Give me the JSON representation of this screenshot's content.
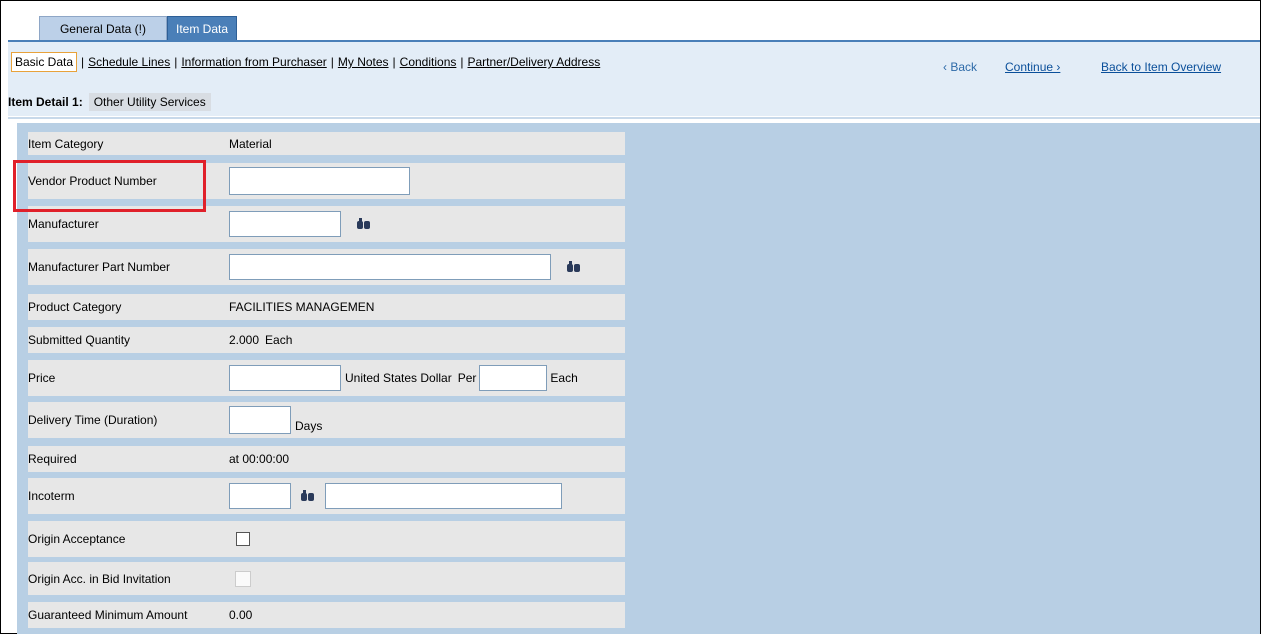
{
  "tabs": [
    {
      "label": "General Data (!)",
      "active": false
    },
    {
      "label": "Item Data",
      "active": true
    }
  ],
  "subnav": {
    "links": [
      "Basic Data",
      "Schedule Lines",
      "Information from Purchaser",
      "My Notes",
      "Conditions",
      "Partner/Delivery Address"
    ],
    "active": "Basic Data",
    "separator": "|",
    "back": "‹ Back",
    "continue": "Continue ›",
    "overview": "Back to Item Overview"
  },
  "detail": {
    "label": "Item Detail 1:",
    "value": "Other Utility Services"
  },
  "fields": {
    "item_category": {
      "label": "Item Category",
      "value": "Material"
    },
    "vendor_product_number": {
      "label": "Vendor Product Number",
      "value": ""
    },
    "manufacturer": {
      "label": "Manufacturer",
      "value": ""
    },
    "manufacturer_part_number": {
      "label": "Manufacturer Part Number",
      "value": ""
    },
    "product_category": {
      "label": "Product Category",
      "value": "FACILITIES MANAGEMEN"
    },
    "submitted_quantity": {
      "label": "Submitted Quantity",
      "value": "2.000",
      "unit": "Each"
    },
    "price": {
      "label": "Price",
      "value": "",
      "currency": "United States Dollar",
      "per_label": "Per",
      "per_value": "",
      "unit": "Each"
    },
    "delivery_time": {
      "label": "Delivery Time (Duration)",
      "value": "",
      "unit": "Days"
    },
    "required": {
      "label": "Required",
      "value": "at 00:00:00"
    },
    "incoterm": {
      "label": "Incoterm",
      "value": "",
      "value2": ""
    },
    "origin_acceptance": {
      "label": "Origin Acceptance",
      "checked": false
    },
    "origin_acc_bid": {
      "label": "Origin Acc. in Bid Invitation",
      "checked": false
    },
    "guaranteed_min": {
      "label": "Guaranteed Minimum Amount",
      "value": "0.00"
    }
  },
  "colors": {
    "tab_active": "#4a7fb8",
    "panel": "#b8cfe4",
    "highlight": "#e0202a"
  }
}
